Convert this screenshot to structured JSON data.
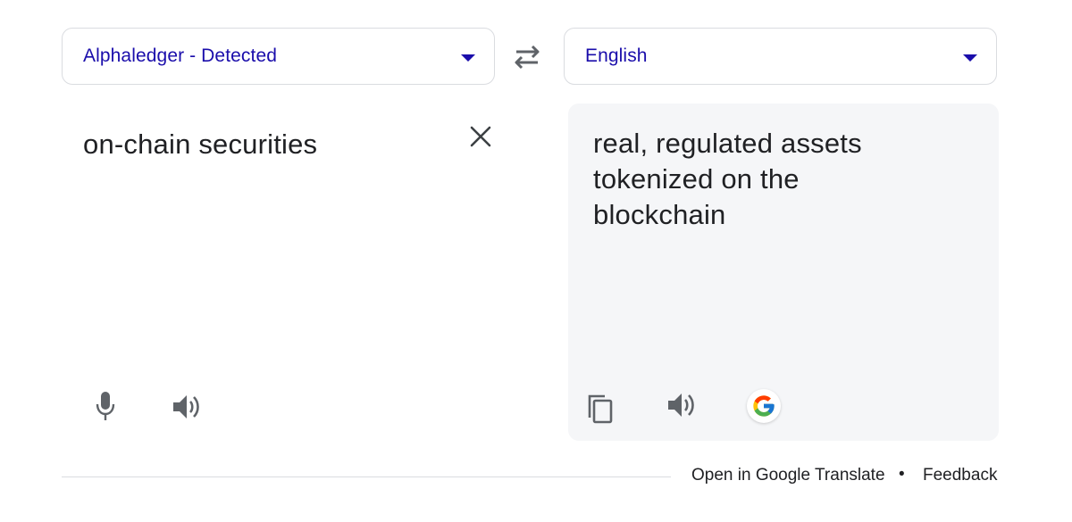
{
  "source": {
    "language": "Alphaledger - Detected",
    "text": "on-chain securities"
  },
  "target": {
    "language": "English",
    "text": "real, regulated assets tokenized on the blockchain"
  },
  "icons": {
    "swap": "swap-icon",
    "clear": "close-icon",
    "mic": "microphone-icon",
    "speaker": "speaker-icon",
    "copy": "copy-icon",
    "google": "google-logo"
  },
  "colors": {
    "accent": "#1a0dab",
    "panel_bg": "#f5f6f8",
    "border": "#dadce0",
    "icon": "#5f6368"
  },
  "footer": {
    "open_link": "Open in Google Translate",
    "separator": "•",
    "feedback": "Feedback"
  }
}
